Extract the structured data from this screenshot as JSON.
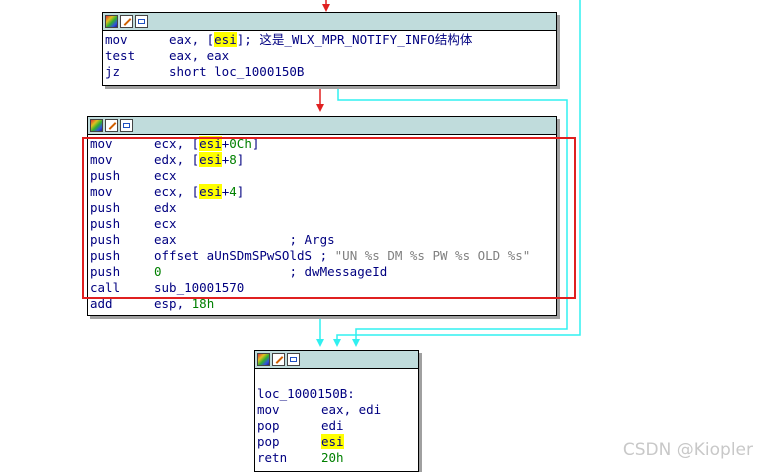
{
  "colors": {
    "header_bg": "#c0dcdc",
    "text": "#000080",
    "number": "#008000",
    "register_highlight": "#ffff00",
    "edge_red": "#e02020",
    "edge_cyan": "#30f0f0",
    "selection_box": "#e02020"
  },
  "header_icons": [
    "palette-icon",
    "edit-icon",
    "graph-icon"
  ],
  "blocks": [
    {
      "id": "block-1",
      "lines": [
        {
          "mnemonic": "mov",
          "pre": "eax, [",
          "reg": "esi",
          "post": "]",
          "comment": "; 这是_WLX_MPR_NOTIFY_INFO结构体"
        },
        {
          "mnemonic": "test",
          "pre": "eax, eax"
        },
        {
          "mnemonic": "jz",
          "pre": "short loc_1000150B"
        }
      ]
    },
    {
      "id": "block-2",
      "lines": [
        {
          "mnemonic": "mov",
          "pre": "ecx, [",
          "reg": "esi",
          "post": "+",
          "num": "0Ch",
          "post2": "]"
        },
        {
          "mnemonic": "mov",
          "pre": "edx, [",
          "reg": "esi",
          "post": "+",
          "num": "8",
          "post2": "]"
        },
        {
          "mnemonic": "push",
          "pre": "ecx"
        },
        {
          "mnemonic": "mov",
          "pre": "ecx, [",
          "reg": "esi",
          "post": "+",
          "num": "4",
          "post2": "]"
        },
        {
          "mnemonic": "push",
          "pre": "edx"
        },
        {
          "mnemonic": "push",
          "pre": "ecx"
        },
        {
          "mnemonic": "push",
          "pre": "eax               ",
          "comment": "; Args"
        },
        {
          "mnemonic": "push",
          "pre": "offset aUnSDmSPwSOldS ",
          "comment": "; ",
          "string": "\"UN %s DM %s PW %s OLD %s\""
        },
        {
          "mnemonic": "push",
          "num": "0",
          "post2": "                 ",
          "comment": "; dwMessageId"
        },
        {
          "mnemonic": "call",
          "pre": "sub_10001570"
        },
        {
          "mnemonic": "add",
          "pre": "esp, ",
          "num": "18h"
        }
      ]
    },
    {
      "id": "block-3",
      "lines": [
        {
          "label": ""
        },
        {
          "label": "loc_1000150B:"
        },
        {
          "mnemonic": "mov",
          "pre": "eax, edi"
        },
        {
          "mnemonic": "pop",
          "pre": "edi"
        },
        {
          "mnemonic": "pop",
          "reg": "esi"
        },
        {
          "mnemonic": "retn",
          "num": "20h"
        }
      ]
    }
  ],
  "watermark": "CSDN @Kiopler"
}
